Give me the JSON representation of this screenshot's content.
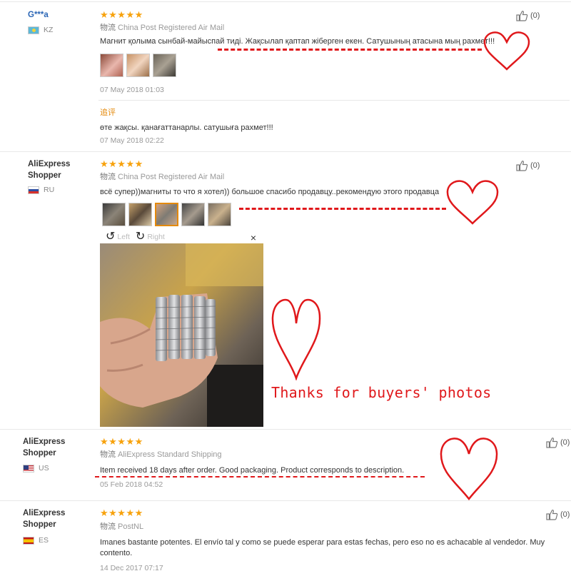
{
  "reviews": [
    {
      "user": "G***a",
      "country": "KZ",
      "stars": "★★★★★",
      "shipping_label": "物流",
      "shipping": "China Post Registered Air Mail",
      "text": "Магнит қолыма сынбай-майыспай тиді. Жақсылап қаптап жіберген екен. Сатушының атасына мың рахмет!!!",
      "date": "07 May 2018 01:03",
      "additional_label": "追评",
      "additional_text": "өте жақсы. қанағаттанарлы. сатушыға рахмет!!!",
      "additional_date": "07 May 2018 02:22",
      "helpful": "(0)"
    },
    {
      "user": "AliExpress Shopper",
      "country": "RU",
      "stars": "★★★★★",
      "shipping_label": "物流",
      "shipping": "China Post Registered Air Mail",
      "text": "всё супер))магниты то что я хотел)) большое спасибо продавцу..рекомендую этого продавца",
      "helpful": "(0)",
      "viewer": {
        "left": "Left",
        "right": "Right",
        "close": "×"
      }
    },
    {
      "user": "AliExpress Shopper",
      "country": "US",
      "stars": "★★★★★",
      "shipping_label": "物流",
      "shipping": "AliExpress Standard Shipping",
      "text": "Item received 18 days after order. Good packaging. Product corresponds to description.",
      "date": "05 Feb 2018 04:52",
      "helpful": "(0)"
    },
    {
      "user": "AliExpress Shopper",
      "country": "ES",
      "stars": "★★★★★",
      "shipping_label": "物流",
      "shipping": "PostNL",
      "text": "Imanes bastante potentes. El envío tal y como se puede esperar para estas fechas, pero eso no es achacable al vendedor. Muy contento.",
      "date": "14 Dec 2017 07:17",
      "helpful": "(0)"
    }
  ],
  "overlay": {
    "caption": "Thanks for buyers' photos",
    "color": "#e0181b"
  },
  "colors": {
    "star": "#f7a20d",
    "link": "#2b66b5",
    "additional": "#e48a0d"
  },
  "icons": [
    "thumbs-up-icon",
    "heart-icon",
    "rotate-left-icon",
    "rotate-right-icon",
    "close-icon"
  ]
}
